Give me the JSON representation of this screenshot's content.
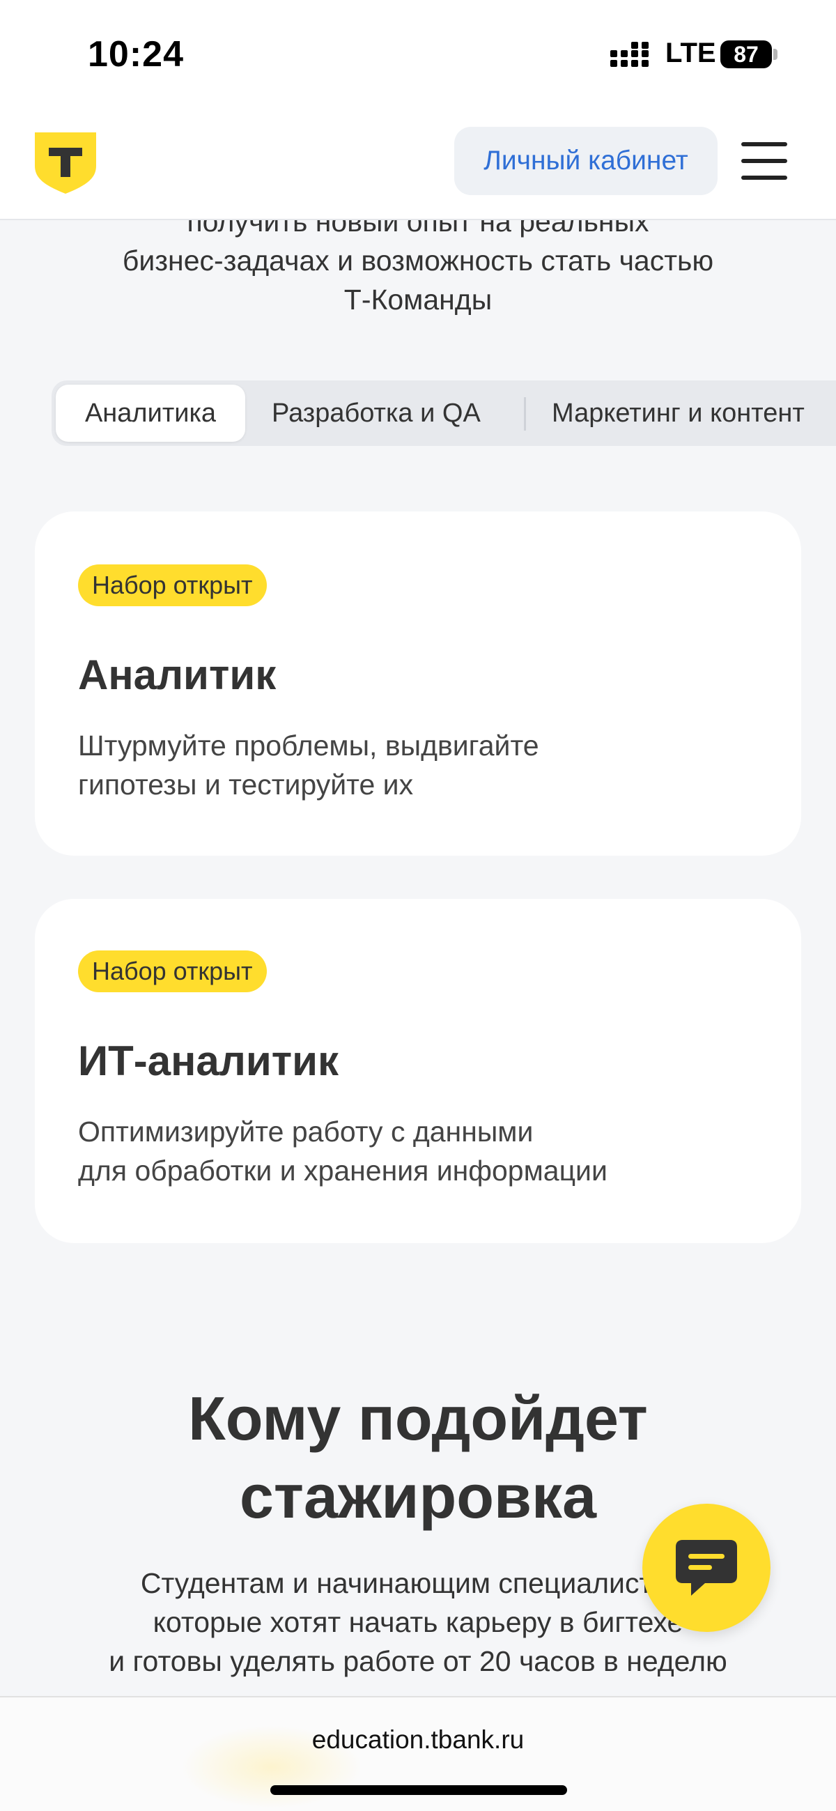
{
  "status_bar": {
    "time": "10:24",
    "network": "LTE",
    "battery": "87"
  },
  "header": {
    "cabinet_label": "Личный кабинет"
  },
  "intro": {
    "lines": [
      "получить новый опыт на реальных",
      "бизнес-задачах и возможность стать частью",
      "Т-Команды"
    ]
  },
  "tabs": [
    {
      "label": "Аналитика",
      "active": true
    },
    {
      "label": "Разработка и QA",
      "active": false
    },
    {
      "label": "Маркетинг и контент",
      "active": false
    }
  ],
  "cards": [
    {
      "badge": "Набор открыт",
      "title": "Аналитик",
      "desc_lines": [
        "Штурмуйте проблемы, выдвигайте",
        "гипотезы и тестируйте их"
      ]
    },
    {
      "badge": "Набор открыт",
      "title": "ИТ-аналитик",
      "desc_lines": [
        "Оптимизируйте работу с данными",
        "для обработки и хранения информации"
      ]
    }
  ],
  "section": {
    "title_lines": [
      "Кому подойдет",
      "стажировка"
    ],
    "text_lines": [
      "Студентам и начинающим специалистам,",
      "которые хотят начать карьеру в бигтехе",
      "и готовы уделять работе от 20 часов в неделю"
    ]
  },
  "browser": {
    "url": "education.tbank.ru"
  },
  "colors": {
    "accent_yellow": "#ffdd2d",
    "link_blue": "#2f6fd6",
    "page_bg": "#f5f6f8"
  }
}
